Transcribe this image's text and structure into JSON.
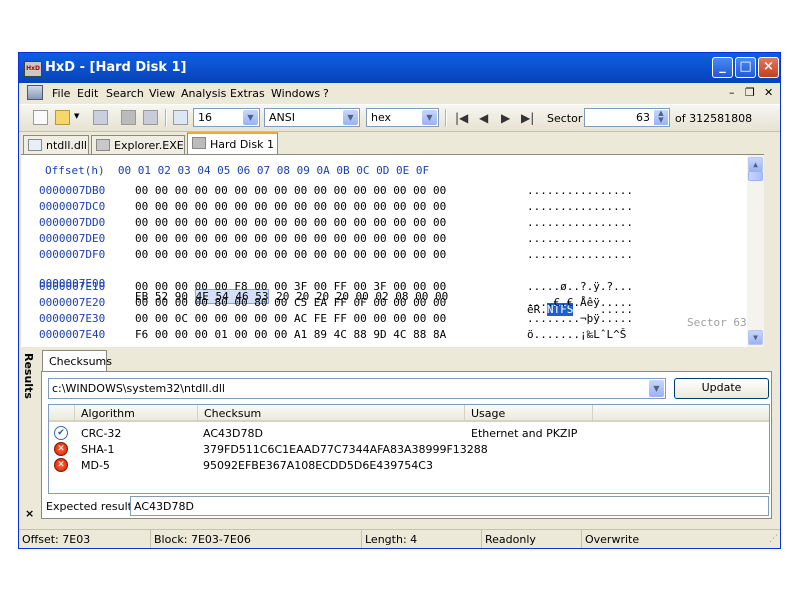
{
  "window": {
    "title": "HxD - [Hard Disk 1]",
    "app_icon_text": "HxD"
  },
  "menu": [
    "File",
    "Edit",
    "Search",
    "View",
    "Analysis",
    "Extras",
    "Windows",
    "?"
  ],
  "toolbar": {
    "bytes_per_row": "16",
    "charset": "ANSI",
    "offset_base": "hex",
    "sector_label": "Sector",
    "sector_value": "63",
    "sector_total": "of 312581808"
  },
  "tabs": [
    "ntdll.dll",
    "Explorer.EXE",
    "Hard Disk 1"
  ],
  "hex": {
    "header": "Offset(h)  00 01 02 03 04 05 06 07 08 09 0A 0B 0C 0D 0E 0F",
    "rows": [
      {
        "offset": "0000007DB0",
        "bytes": "00 00 00 00 00 00 00 00 00 00 00 00 00 00 00 00",
        "ascii": "................"
      },
      {
        "offset": "0000007DC0",
        "bytes": "00 00 00 00 00 00 00 00 00 00 00 00 00 00 00 00",
        "ascii": "................"
      },
      {
        "offset": "0000007DD0",
        "bytes": "00 00 00 00 00 00 00 00 00 00 00 00 00 00 00 00",
        "ascii": "................"
      },
      {
        "offset": "0000007DE0",
        "bytes": "00 00 00 00 00 00 00 00 00 00 00 00 00 00 00 00",
        "ascii": "................"
      },
      {
        "offset": "0000007DF0",
        "bytes": "00 00 00 00 00 00 00 00 00 00 00 00 00 00 00 00",
        "ascii": "................"
      },
      {
        "offset": "0000007E00",
        "bytes_pre": "EB 52 90 ",
        "bytes_sel": "4E 54 46 53",
        "bytes_post": " 20 20 20 20 00 02 08 00 00",
        "ascii_pre": "ëR.",
        "ascii_sel": "NTFS",
        "ascii_post": "    .....",
        "sector_mark": "Sector 63"
      },
      {
        "offset": "0000007E10",
        "bytes": "00 00 00 00 00 F8 00 00 3F 00 FF 00 3F 00 00 00",
        "ascii": ".....ø..?.ÿ.?..."
      },
      {
        "offset": "0000007E20",
        "bytes": "00 00 00 00 80 00 80 00 C5 EA FF 0F 00 00 00 00",
        "ascii": "....€.€.Åêÿ....."
      },
      {
        "offset": "0000007E30",
        "bytes": "00 00 0C 00 00 00 00 00 AC FE FF 00 00 00 00 00",
        "ascii": "........¬þÿ....."
      },
      {
        "offset": "0000007E40",
        "bytes": "F6 00 00 00 01 00 00 00 A1 89 4C 88 9D 4C 88 8A",
        "ascii": "ö.......¡‰LˆL^Š"
      }
    ]
  },
  "results": {
    "label": "Results",
    "close_glyph": "×",
    "tab": "Checksums",
    "file": "c:\\WINDOWS\\system32\\ntdll.dll",
    "update_label": "Update",
    "columns": [
      "Algorithm",
      "Checksum",
      "Usage"
    ],
    "rows": [
      {
        "status": "ok",
        "algorithm": "CRC-32",
        "checksum": "AC43D78D",
        "usage": "Ethernet and PKZIP"
      },
      {
        "status": "bad",
        "algorithm": "SHA-1",
        "checksum": "379FD511C6C1EAAD77C7344AFA83A38999F13288",
        "usage": ""
      },
      {
        "status": "bad",
        "algorithm": "MD-5",
        "checksum": "95092EFBE367A108ECDD5D6E439754C3",
        "usage": ""
      }
    ],
    "expected_label": "Expected result:",
    "expected_value": "AC43D78D"
  },
  "status": {
    "offset": "Offset: 7E03",
    "block": "Block: 7E03-7E06",
    "length": "Length: 4",
    "mode": "Readonly",
    "insert": "Overwrite"
  },
  "colors": {
    "title_bar": "#0b54d4",
    "offset_text": "#1a3fb0",
    "selection": "#1c5fd0",
    "tab_accent": "#f0a830"
  }
}
